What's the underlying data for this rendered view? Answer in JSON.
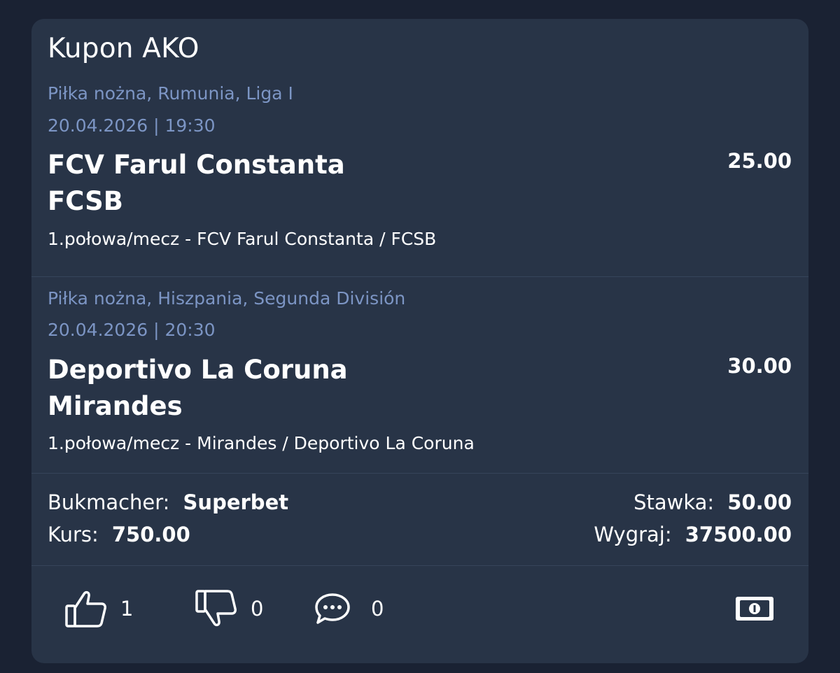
{
  "card": {
    "title": "Kupon AKO"
  },
  "events": [
    {
      "sport_league": "Piłka nożna,  Rumunia, Liga I",
      "datetime": "20.04.2026 | 19:30",
      "team_home": "FCV Farul Constanta",
      "team_away": "FCSB",
      "odds": "25.00",
      "bet": "1.połowa/mecz - FCV Farul Constanta / FCSB"
    },
    {
      "sport_league": "Piłka nożna,  Hiszpania, Segunda División",
      "datetime": "20.04.2026 | 20:30",
      "team_home": "Deportivo La Coruna",
      "team_away": "Mirandes",
      "odds": "30.00",
      "bet": "1.połowa/mecz - Mirandes / Deportivo La Coruna"
    }
  ],
  "summary": {
    "bookmaker_label": "Bukmacher:",
    "bookmaker_value": "Superbet",
    "odds_label": "Kurs:",
    "odds_value": "750.00",
    "stake_label": "Stawka:",
    "stake_value": "50.00",
    "win_label": "Wygraj:",
    "win_value": "37500.00"
  },
  "actions": {
    "likes": "1",
    "dislikes": "0",
    "comments": "0",
    "like_icon": "thumbs-up-icon",
    "dislike_icon": "thumbs-down-icon",
    "comment_icon": "comment-icon",
    "money_icon": "money-icon"
  },
  "colors": {
    "background": "#1a2233",
    "card": "#283447",
    "meta_text": "#7c95c4",
    "divider": "#36445a"
  }
}
